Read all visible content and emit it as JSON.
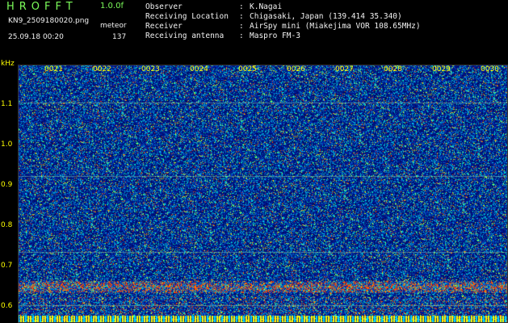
{
  "header": {
    "app_title": "HROFFT",
    "version": "1.0.0f",
    "filename": "KN9_2509180020.png",
    "meteor_label": "meteor",
    "datetime": "25.09.18 00:20",
    "meteor_count": "137"
  },
  "station_info": [
    {
      "label": "Observer",
      "value": "K.Nagai"
    },
    {
      "label": "Receiving Location",
      "value": "Chigasaki, Japan (139.414 35.340)"
    },
    {
      "label": "Receiver",
      "value": "AirSpy mini (Miakejima VOR 108.65MHz)"
    },
    {
      "label": "Receiving antenna",
      "value": "Maspro FM-3"
    }
  ],
  "axes": {
    "y_unit": "kHz",
    "y_ticks": [
      "1.1",
      "1.0",
      "0.9",
      "0.8",
      "0.7",
      "0.6"
    ],
    "x_ticks": [
      "0021",
      "0022",
      "0023",
      "0024",
      "0025",
      "0026",
      "0027",
      "0028",
      "0029",
      "0030"
    ]
  },
  "colors": {
    "background": "#000000",
    "noise_base": "#0a14a0",
    "header_green": "#7cfc5a",
    "axis_yellow": "#ffff00",
    "carrier_band": "#ff2a00"
  }
}
